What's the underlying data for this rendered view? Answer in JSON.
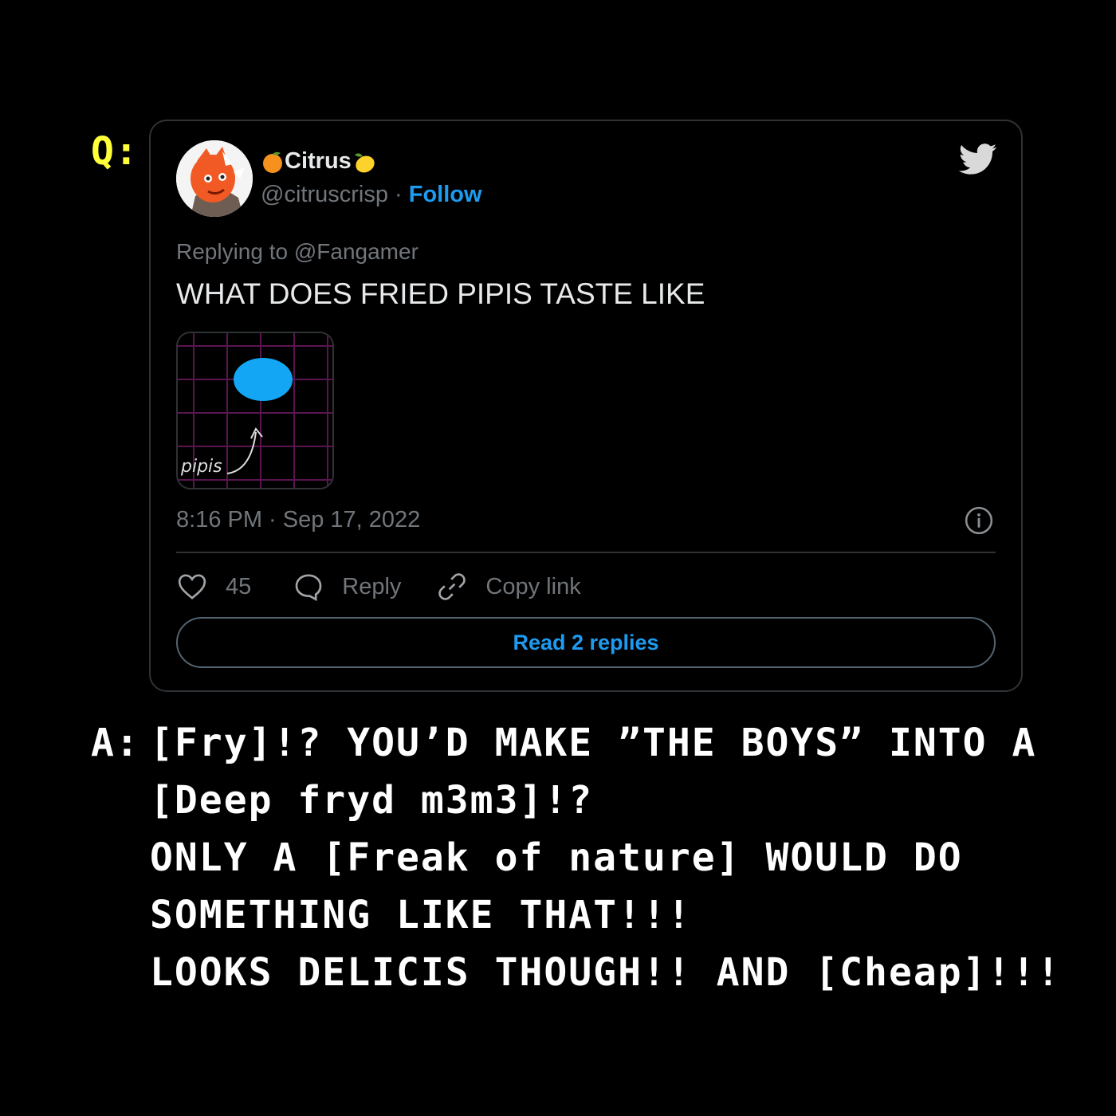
{
  "question_label": "Q:",
  "tweet": {
    "display_name": "Citrus",
    "name_emoji_left": "orange-emoji",
    "name_emoji_right": "lemon-emoji",
    "handle": "@citruscrisp",
    "separator": " · ",
    "follow_label": "Follow",
    "replying_to": "Replying to @Fangamer",
    "text": "WHAT DOES FRIED PIPIS TASTE LIKE",
    "media_caption": "pipis",
    "timestamp": "8:16 PM · Sep 17, 2022",
    "like_count": "45",
    "reply_label": "Reply",
    "copy_link_label": "Copy link",
    "read_replies_label": "Read 2 replies",
    "icons": {
      "brand": "twitter-bird-icon",
      "info": "info-icon",
      "like": "heart-icon",
      "reply": "speech-bubble-icon",
      "copy": "link-icon"
    },
    "colors": {
      "accent": "#1d9bf0",
      "muted": "#71767b",
      "border": "#2f3336",
      "pipis": "#12a6f5",
      "grid": "#5a1550"
    }
  },
  "answer": {
    "label": "A:",
    "lines": [
      "[Fry]!? YOU’D MAKE ”THE BOYS” INTO A",
      "[Deep fryd m3m3]!?",
      "ONLY A [Freak of nature] WOULD DO",
      "SOMETHING LIKE THAT!!!",
      "LOOKS DELICIS THOUGH!! AND [Cheap]!!!"
    ]
  },
  "colors": {
    "background": "#000000",
    "question_label": "#ffff3a",
    "answer_text": "#ffffff"
  }
}
